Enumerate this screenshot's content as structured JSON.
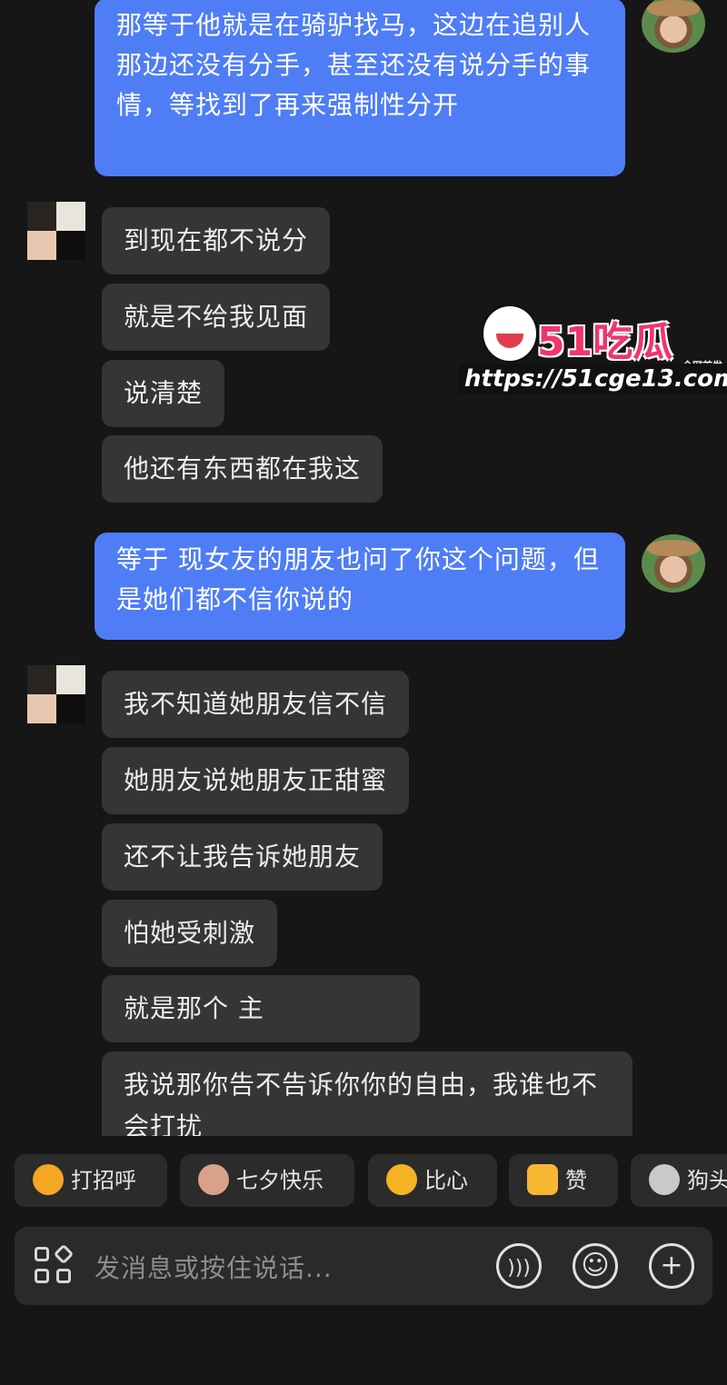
{
  "messages": {
    "out1": "那等于他就是在骑驴找马，这边在追别人那边还没有分手，甚至还没有说分手的事情，等找到了再来强制性分开",
    "in1": [
      "到现在都不说分",
      "就是不给我见面",
      "说清楚",
      "他还有东西都在我这"
    ],
    "out2": "等于 现女友的朋友也问了你这个问题，但是她们都不信你说的",
    "in2": [
      "我不知道她朋友信不信",
      "她朋友说她朋友正甜蜜",
      "还不让我告诉她朋友",
      "怕她受刺激",
      "就是那个  主",
      "我说那你告不告诉你你的自由，我谁也不会打扰"
    ]
  },
  "watermark": {
    "brand": "51吃瓜",
    "tag": "全网首发",
    "url": "https://51cge13.com"
  },
  "quick_replies": [
    {
      "label": "打招呼",
      "icon": "smile-emoji-icon",
      "color": "#f5a623"
    },
    {
      "label": "七夕快乐",
      "icon": "magpie-icon",
      "color": "#d9a08a"
    },
    {
      "label": "比心",
      "icon": "heart-hand-emoji-icon",
      "color": "#f5b323"
    },
    {
      "label": "赞",
      "icon": "thumbs-up-icon",
      "color": "#f7b733"
    },
    {
      "label": "狗头",
      "icon": "doge-icon",
      "color": "#c9c9c9"
    }
  ],
  "input": {
    "placeholder": "发消息或按住说话..."
  }
}
